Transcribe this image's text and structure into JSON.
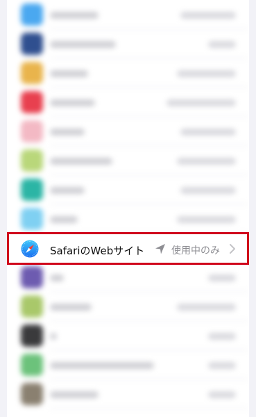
{
  "focused_row": {
    "app_label": "SafariのWebサイト",
    "permission_value": "使用中のみ",
    "app_icon": "safari-compass-icon",
    "location_icon": "location-arrow-icon",
    "chevron_icon": "chevron-right-icon"
  },
  "colors": {
    "highlight_border": "#d0021b",
    "background": "#f2f2f7",
    "value_text": "#8e8e93"
  },
  "blurred_rows": [
    {
      "icon": "blurred-app-icon",
      "icon_color": "#4aa8f0"
    },
    {
      "icon": "blurred-app-icon",
      "icon_color": "#2f4f8f"
    },
    {
      "icon": "blurred-app-icon",
      "icon_color": "#e9b44c"
    },
    {
      "icon": "blurred-app-icon",
      "icon_color": "#e8404f"
    },
    {
      "icon": "blurred-app-icon",
      "icon_color": "#f3b9c4"
    },
    {
      "icon": "blurred-app-icon",
      "icon_color": "#b9d77a"
    },
    {
      "icon": "blurred-app-icon",
      "icon_color": "#2bb5a5"
    },
    {
      "icon": "blurred-app-icon",
      "icon_color": "#7fd0f2"
    },
    {
      "icon": "blurred-app-icon",
      "icon_color": "#6d5bb0"
    },
    {
      "icon": "blurred-app-icon",
      "icon_color": "#a9c86a"
    },
    {
      "icon": "blurred-app-icon",
      "icon_color": "#3a3a3c"
    },
    {
      "icon": "blurred-app-icon",
      "icon_color": "#6cc27b"
    },
    {
      "icon": "blurred-app-icon",
      "icon_color": "#8a8070"
    }
  ]
}
